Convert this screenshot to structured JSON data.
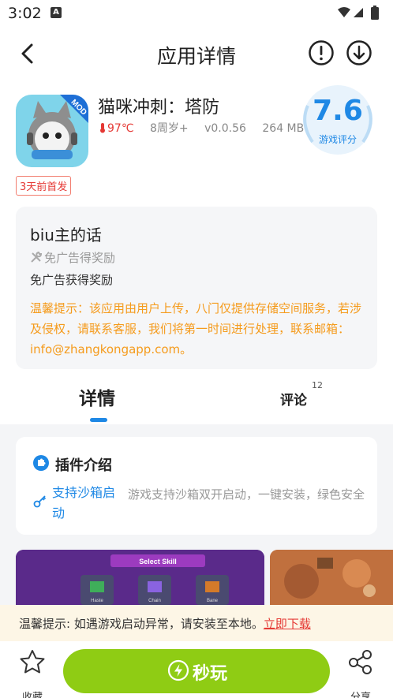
{
  "status_bar": {
    "time": "3:02",
    "notification_badge": "A"
  },
  "nav": {
    "title": "应用详情",
    "icons": [
      "back-arrow-icon",
      "alert-icon",
      "download-icon"
    ]
  },
  "app": {
    "name": "猫咪冲刺：塔防",
    "icon_badge": "MOD",
    "temperature": "97℃",
    "age_rating": "8周岁+",
    "version": "v0.0.56",
    "size": "264 MB",
    "new_tag": "3天前首发",
    "score": "7.6",
    "score_label": "游戏评分"
  },
  "notice_card": {
    "title": "biu主的话",
    "subtitle": "免广告得奖励",
    "description": "免广告获得奖励",
    "warning": "温馨提示：该应用由用户上传，八门仅提供存储空间服务，若涉及侵权，请联系客服，我们将第一时间进行处理，联系邮箱：info@zhangkongapp.com。"
  },
  "tabs": {
    "detail": "详情",
    "comments": "评论",
    "comments_count": "12"
  },
  "plugin_card": {
    "title": "插件介绍",
    "feature": "支持沙箱启动",
    "feature_desc": "游戏支持沙箱双开启动，一键安装，绿色安全"
  },
  "screenshot": {
    "header": "Select Skill",
    "skills": [
      "Haste",
      "Chain",
      "Bane"
    ]
  },
  "tip_bar": {
    "text": "温馨提示: 如遇游戏启动异常，请安装至本地。",
    "link": "立即下载"
  },
  "bottom_bar": {
    "favorite": "收藏",
    "play": "秒玩",
    "share": "分享"
  },
  "colors": {
    "accent": "#1e88e5",
    "play_button": "#8fcc14",
    "warning": "#f59b1c",
    "hot": "#e53935"
  }
}
